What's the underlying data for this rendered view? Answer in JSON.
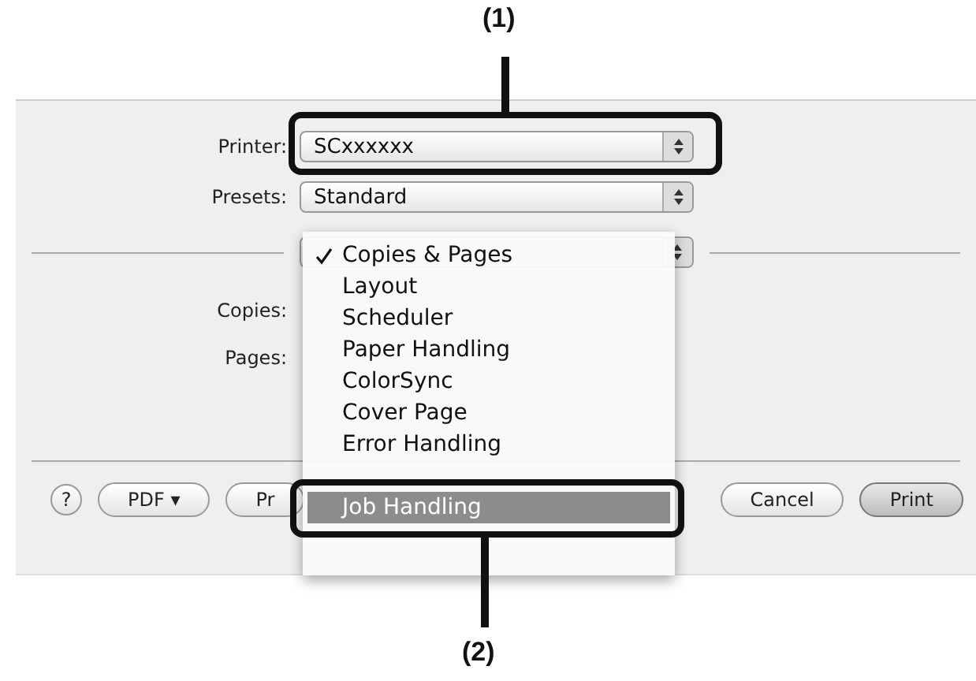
{
  "callouts": [
    {
      "label": "(1)"
    },
    {
      "label": "(2)"
    }
  ],
  "printer": {
    "label": "Printer:",
    "value": "SCxxxxxx"
  },
  "presets": {
    "label": "Presets:",
    "value": "Standard"
  },
  "copies": {
    "label": "Copies:"
  },
  "pages": {
    "label": "Pages:"
  },
  "menu": {
    "items": [
      {
        "label": "Copies & Pages",
        "checked": true,
        "selected": false
      },
      {
        "label": "Layout",
        "checked": false,
        "selected": false
      },
      {
        "label": "Scheduler",
        "checked": false,
        "selected": false
      },
      {
        "label": "Paper Handling",
        "checked": false,
        "selected": false
      },
      {
        "label": "ColorSync",
        "checked": false,
        "selected": false
      },
      {
        "label": "Cover Page",
        "checked": false,
        "selected": false
      },
      {
        "label": "Error Handling",
        "checked": false,
        "selected": false
      },
      {
        "label": "Job Handling",
        "checked": false,
        "selected": true
      }
    ]
  },
  "buttons": [
    {
      "kind": "help",
      "label": "?"
    },
    {
      "kind": "menu",
      "label": "PDF ▾"
    },
    {
      "kind": "plain",
      "label": "Pr"
    },
    {
      "kind": "spacer"
    },
    {
      "kind": "plain",
      "label": "Cancel"
    },
    {
      "kind": "default",
      "label": "Print"
    }
  ]
}
